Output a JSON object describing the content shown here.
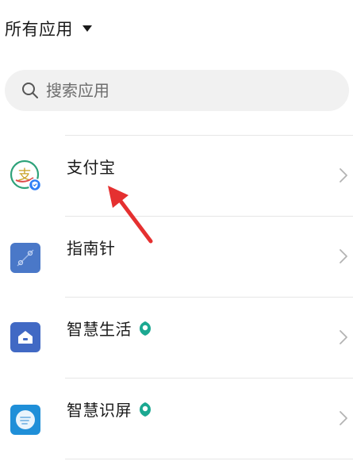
{
  "header": {
    "title": "所有应用"
  },
  "search": {
    "placeholder": "搜索应用"
  },
  "apps": [
    {
      "name": "支付宝"
    },
    {
      "name": "指南针"
    },
    {
      "name": "智慧生活"
    },
    {
      "name": "智慧识屏"
    }
  ],
  "colors": {
    "accent_blue": "#3a7bd5",
    "alipay_green": "#2ea27a",
    "alipay_badge": "#2d7ef5",
    "compass_blue": "#4a78c8",
    "smart_life_blue": "#4169c4",
    "screen_reader_blue": "#1f8fd8",
    "leaf_teal": "#1ba891",
    "annotation_red": "#e53030"
  },
  "icons": {
    "header_caret": "caret-down-icon",
    "search": "search-icon",
    "row_chevron": "chevron-right-icon",
    "badge": "leaf-badge-icon"
  }
}
